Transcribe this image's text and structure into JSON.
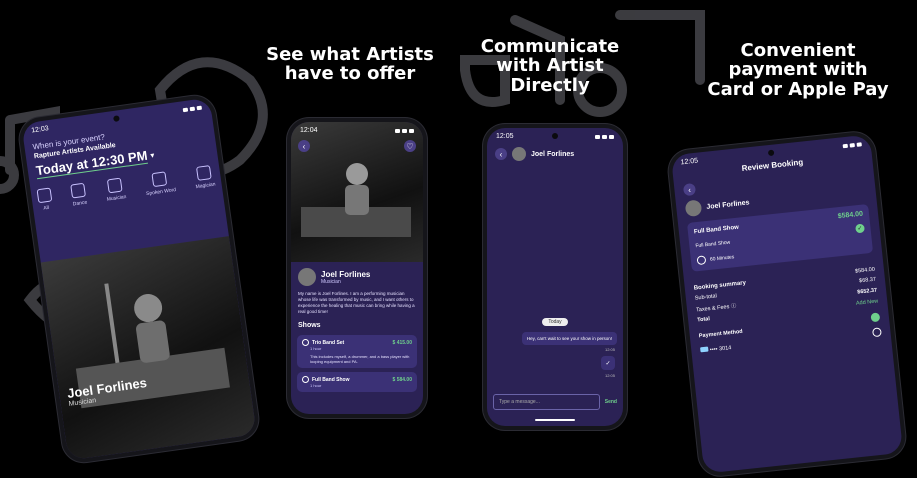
{
  "headlines": {
    "artists": "See what Artists\nhave to offer",
    "communicate": "Communicate\nwith Artist\nDirectly",
    "payment": "Convenient\npayment with\nCard or Apple Pay"
  },
  "colors": {
    "background": "#000000",
    "screen": "#2b2255",
    "card": "#3b3176",
    "accent": "#6fd08c"
  },
  "phone1": {
    "time": "12:03",
    "question": "When is your event?",
    "availability": "Rapture Artists Available",
    "datetime": "Today at 12:30 PM",
    "categories": [
      {
        "label": "All",
        "icon": "sparkle-icon"
      },
      {
        "label": "Dance",
        "icon": "dancer-icon"
      },
      {
        "label": "Musician",
        "icon": "guitar-icon"
      },
      {
        "label": "Spoken Word",
        "icon": "microphone-icon"
      },
      {
        "label": "Magician",
        "icon": "hat-icon"
      }
    ],
    "artist_name": "Joel Forlines",
    "artist_role": "Musician"
  },
  "phone2": {
    "time": "12:04",
    "artist_name": "Joel Forlines",
    "artist_role": "Musician",
    "bio": "My name is Joel Forlines. I am a performing musician whose life was transformed by music, and I want others to experience the healing that music can bring while having a real good time!",
    "shows_title": "Shows",
    "shows": [
      {
        "name": "Trio Band Set",
        "duration": "1 hour",
        "price": "$ 415.00",
        "desc": "This includes myself, a drummer, and a bass player with looping equipment and PA."
      },
      {
        "name": "Full Band Show",
        "duration": "1 hour",
        "price": "$ 584.00",
        "desc": ""
      }
    ]
  },
  "phone3": {
    "time": "12:05",
    "contact": "Joel Forlines",
    "date_chip": "Today",
    "message": "Hey, can't wait to see your show in person!",
    "message_time": "12:05",
    "reply_time": "12:05",
    "input_placeholder": "Type a message...",
    "send_label": "Send"
  },
  "phone4": {
    "time": "12:05",
    "title": "Review Booking",
    "artist_name": "Joel Forlines",
    "show_name": "Full Band Show",
    "show_price": "$584.00",
    "selected_show": "Full Band Show",
    "duration": "60 Minutes",
    "summary_title": "Booking summary",
    "summary_amount": "$584.00",
    "subtotal_label": "Sub-total",
    "subtotal": "$68.37",
    "taxes_label": "Taxes & Fees",
    "taxes": "$652.37",
    "total_label": "Total",
    "payment_title": "Payment Method",
    "add_new": "Add New",
    "card": "•••• 3014"
  }
}
